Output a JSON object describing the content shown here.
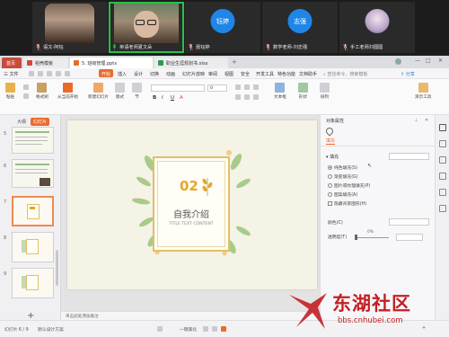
{
  "meeting": {
    "participants": [
      {
        "name": "语文-阿钰",
        "avatar_text": "",
        "muted": true
      },
      {
        "name": "英语老师夏文朵",
        "avatar_text": "",
        "muted": false,
        "speaking": true
      },
      {
        "name": "聂钰婷",
        "avatar_text": "钰婷",
        "muted": true
      },
      {
        "name": "数学老师-刘志强",
        "avatar_text": "志强",
        "muted": true
      },
      {
        "name": "手工老师刘圆圆",
        "avatar_text": "",
        "muted": true
      }
    ]
  },
  "app": {
    "home_tab": "首页",
    "tabs": [
      {
        "label": "稻壳模板",
        "color": "#d9433a"
      },
      {
        "label": "5. 班级管理.pptx",
        "color": "#e96b2a"
      },
      {
        "label": "职业生涯规划书.xlsx",
        "color": "#2b9a4e"
      }
    ],
    "menu": {
      "file": "三 文件",
      "start": "开始",
      "items": [
        "插入",
        "设计",
        "切换",
        "动画",
        "幻灯片放映",
        "审阅",
        "视图",
        "安全",
        "开发工具",
        "特色功能",
        "文档助手"
      ],
      "search": "查找命令、搜索模板",
      "share": "分享"
    },
    "ribbon": {
      "paste": "粘贴",
      "format_painter": "格式刷",
      "from_current": "从当前开始",
      "new_slide": "新建幻灯片",
      "layout": "版式",
      "section": "节",
      "font_size": "0",
      "text_box": "文本框",
      "shape": "形状",
      "arrange": "排列",
      "quick_style": "演示工具"
    },
    "left_panel": {
      "tab_outline": "大纲",
      "tab_slides": "幻灯片",
      "slide_numbers": [
        "5",
        "6",
        "7",
        "8",
        "9"
      ]
    },
    "slide": {
      "number": "02",
      "title": "自我介绍",
      "subtitle": "TITLE TEXT CONTENT"
    },
    "notes": "单击此处添加备注",
    "right_panel": {
      "title": "对象属性",
      "tab_fill": "填充",
      "section": "填充",
      "options": [
        "纯色填充(S)",
        "渐变填充(G)",
        "图片或纹理填充(P)",
        "图案填充(A)",
        "隐藏背景图形(H)"
      ],
      "selected_option": 0,
      "color_label": "颜色(C)",
      "transparency_label": "透明度(T)",
      "transparency_value": "0%"
    },
    "status": {
      "slide_count": "幻灯片 6 / 9",
      "theme": "默认设计方案",
      "smart_beauty": "一键美化",
      "zoom": "+"
    }
  },
  "watermark": {
    "text": "东湖社区",
    "url": "bbs.cnhubei.com"
  }
}
